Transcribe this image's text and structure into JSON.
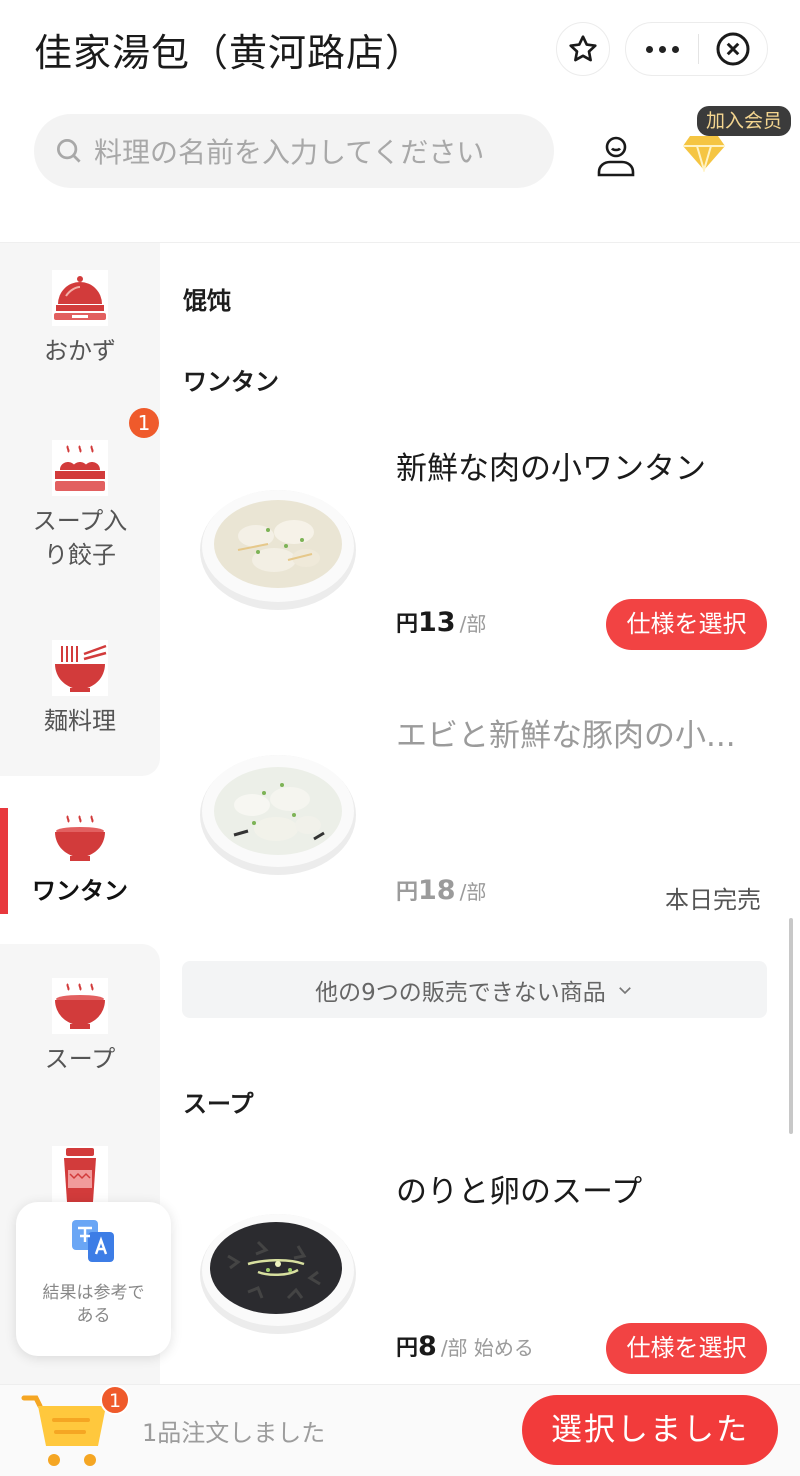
{
  "header": {
    "store_title": "佳家湯包（黄河路店）",
    "icons": {
      "favorite": "star-icon",
      "more": "more-dots-icon",
      "close": "close-circle-icon"
    }
  },
  "search": {
    "placeholder": "料理の名前を入力してください",
    "icon": "search-icon"
  },
  "member": {
    "user_icon": "user-icon",
    "vip_icon": "diamond-icon",
    "join_label": "加入会员"
  },
  "sidebar": {
    "items": [
      {
        "label": "おかず",
        "icon": "covered-dish-icon"
      },
      {
        "label": "スープ入り餃子",
        "label_lines": [
          "スープ入",
          "り餃子"
        ],
        "icon": "steamer-icon",
        "badge": "1"
      },
      {
        "label": "麺料理",
        "icon": "noodle-bowl-icon"
      },
      {
        "label": "ワンタン",
        "icon": "wonton-bowl-icon",
        "active": true
      },
      {
        "label": "スープ",
        "icon": "soup-bowl-icon"
      },
      {
        "label": "",
        "icon": "drink-cup-icon"
      }
    ],
    "active_color": "#e8383d"
  },
  "content": {
    "category_cn": "馄饨",
    "section_wonton": "ワンタン",
    "products": [
      {
        "name": "新鮮な肉の小ワンタン",
        "currency": "円",
        "price": "13",
        "unit": "/部",
        "action": "仕様を選択"
      },
      {
        "name": "エビと新鮮な豚肉の小...",
        "currency": "円",
        "price": "18",
        "unit": "/部",
        "status": "本日完売"
      }
    ],
    "unavailable_more": "他の9つの販売できない商品",
    "section_soup": "スープ",
    "soup_products": [
      {
        "name": "のりと卵のスープ",
        "currency": "円",
        "price": "8",
        "unit": "/部 始める",
        "action": "仕様を選択"
      }
    ]
  },
  "translate_card": {
    "text": "結果は参考である",
    "text_lines": [
      "結果は参考で",
      "ある"
    ],
    "icon": "translate-icon"
  },
  "bottom_bar": {
    "cart_icon": "cart-icon",
    "cart_count": "1",
    "cart_text": "1品注文しました",
    "checkout_label": "選択しました"
  },
  "colors": {
    "accent_red": "#f24343",
    "badge_orange": "#ef5a2b",
    "vip_gold": "#f5c542"
  }
}
